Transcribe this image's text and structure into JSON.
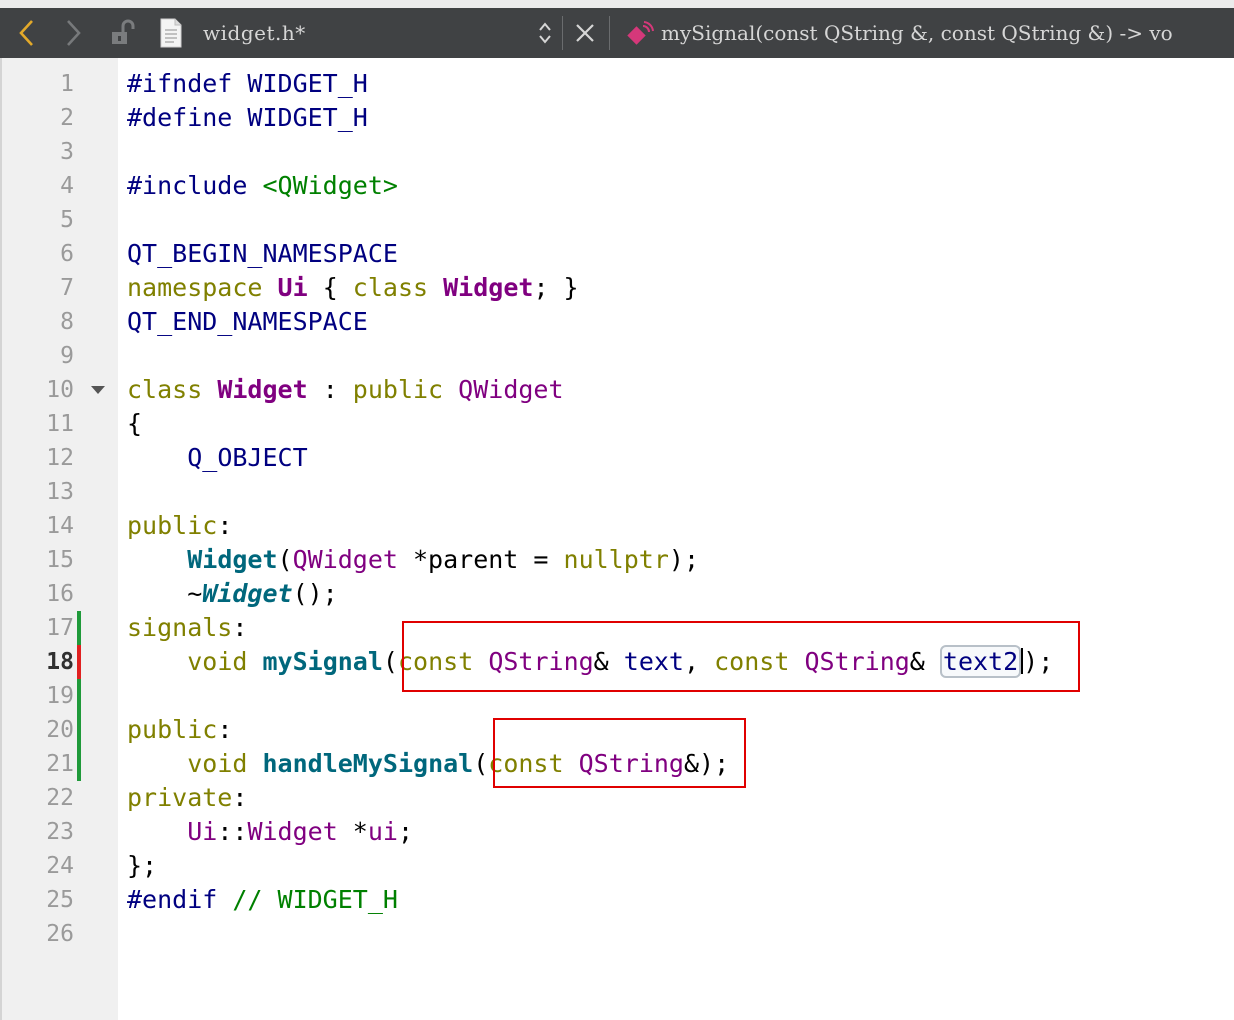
{
  "toolbar": {
    "file_name": "widget.h*",
    "symbol": "mySignal(const QString &, const QString &) -> vo"
  },
  "editor": {
    "lines": [
      [
        {
          "t": "#ifndef WIDGET_H",
          "c": "pp"
        }
      ],
      [
        {
          "t": "#define WIDGET_H",
          "c": "pp"
        }
      ],
      [],
      [
        {
          "t": "#include ",
          "c": "pp"
        },
        {
          "t": "<QWidget>",
          "c": "str"
        }
      ],
      [],
      [
        {
          "t": "QT_BEGIN_NAMESPACE",
          "c": "mac"
        }
      ],
      [
        {
          "t": "namespace",
          "c": "kw"
        },
        {
          "t": " "
        },
        {
          "t": "Ui",
          "c": "def"
        },
        {
          "t": " { "
        },
        {
          "t": "class",
          "c": "kw"
        },
        {
          "t": " "
        },
        {
          "t": "Widget",
          "c": "def"
        },
        {
          "t": "; }"
        }
      ],
      [
        {
          "t": "QT_END_NAMESPACE",
          "c": "mac"
        }
      ],
      [],
      [
        {
          "t": "class",
          "c": "kw"
        },
        {
          "t": " "
        },
        {
          "t": "Widget",
          "c": "def"
        },
        {
          "t": " : "
        },
        {
          "t": "public",
          "c": "kw"
        },
        {
          "t": " "
        },
        {
          "t": "QWidget",
          "c": "ty"
        }
      ],
      [
        {
          "t": "{"
        }
      ],
      [
        {
          "t": "    "
        },
        {
          "t": "Q_OBJECT",
          "c": "mac"
        }
      ],
      [],
      [
        {
          "t": "public",
          "c": "kw"
        },
        {
          "t": ":"
        }
      ],
      [
        {
          "t": "    "
        },
        {
          "t": "Widget",
          "c": "fn"
        },
        {
          "t": "("
        },
        {
          "t": "QWidget",
          "c": "ty"
        },
        {
          "t": " *parent = "
        },
        {
          "t": "nullptr",
          "c": "kw"
        },
        {
          "t": ");"
        }
      ],
      [
        {
          "t": "    ~"
        },
        {
          "t": "Widget",
          "c": "fni"
        },
        {
          "t": "();"
        }
      ],
      [
        {
          "t": "signals",
          "c": "kw"
        },
        {
          "t": ":"
        }
      ],
      [
        {
          "t": "    "
        },
        {
          "t": "void",
          "c": "kw"
        },
        {
          "t": " "
        },
        {
          "t": "mySignal",
          "c": "fn"
        },
        {
          "t": "("
        },
        {
          "t": "const",
          "c": "kw"
        },
        {
          "t": " "
        },
        {
          "t": "QString",
          "c": "ty"
        },
        {
          "t": "& "
        },
        {
          "t": "text",
          "c": "pp"
        },
        {
          "t": ", "
        },
        {
          "t": "const",
          "c": "kw"
        },
        {
          "t": " "
        },
        {
          "t": "QString",
          "c": "ty"
        },
        {
          "t": "& "
        },
        {
          "t": "text2",
          "c": "pp hl"
        },
        {
          "t": "",
          "c": "cursor"
        },
        {
          "t": ");"
        }
      ],
      [],
      [
        {
          "t": "public",
          "c": "kw"
        },
        {
          "t": ":"
        }
      ],
      [
        {
          "t": "    "
        },
        {
          "t": "void",
          "c": "kw"
        },
        {
          "t": " "
        },
        {
          "t": "handleMySignal",
          "c": "fn"
        },
        {
          "t": "("
        },
        {
          "t": "const",
          "c": "kw"
        },
        {
          "t": " "
        },
        {
          "t": "QString",
          "c": "ty"
        },
        {
          "t": "&);"
        }
      ],
      [
        {
          "t": "private",
          "c": "kw"
        },
        {
          "t": ":"
        }
      ],
      [
        {
          "t": "    "
        },
        {
          "t": "Ui",
          "c": "ty"
        },
        {
          "t": "::"
        },
        {
          "t": "Widget",
          "c": "ty"
        },
        {
          "t": " *"
        },
        {
          "t": "ui",
          "c": "ty"
        },
        {
          "t": ";"
        }
      ],
      [
        {
          "t": "};"
        }
      ],
      [
        {
          "t": "#endif ",
          "c": "pp"
        },
        {
          "t": "// WIDGET_H",
          "c": "cm"
        }
      ],
      []
    ],
    "current_line": 18,
    "fold_line": 10,
    "changed_lines_green": [
      17,
      19,
      20,
      21
    ],
    "changed_lines_red": [
      18
    ],
    "colors": {
      "toolbar_bg": "#404244",
      "gutter_bg": "#f0f0f0",
      "keyword": "#808000",
      "type": "#800080",
      "function": "#00677c",
      "string": "#008000",
      "annotation_box": "#e00000"
    }
  }
}
